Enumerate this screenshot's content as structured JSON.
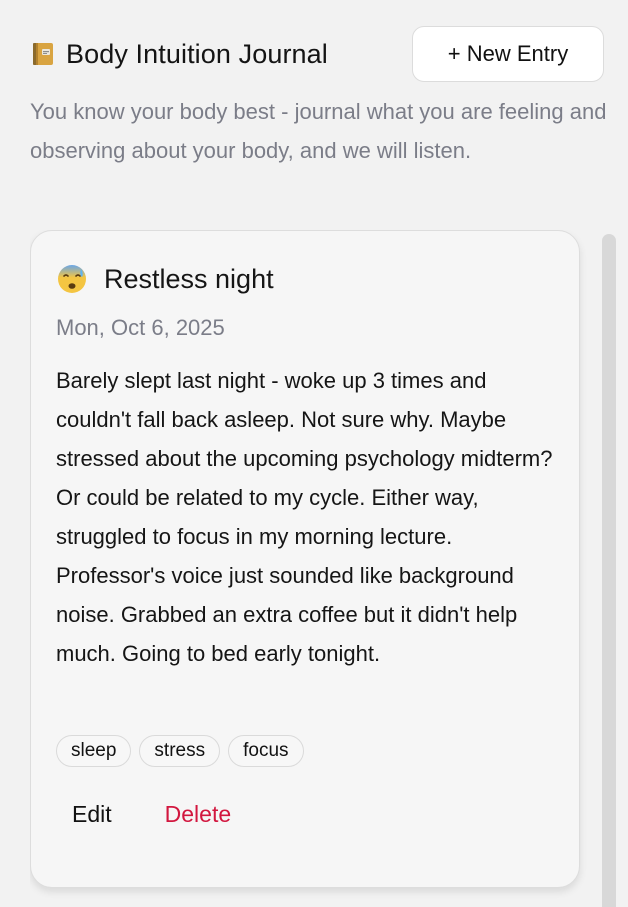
{
  "header": {
    "title": "Body Intuition Journal",
    "title_icon": "notebook-icon",
    "new_entry_label": "+ New Entry"
  },
  "subtitle": "You know your body best - journal what you are feeling and observing about your body, and we will listen.",
  "entries": [
    {
      "mood_icon": "anxious-sweat-face-icon",
      "title": "Restless night",
      "date": "Mon, Oct 6, 2025",
      "body": "Barely slept last night - woke up 3 times and couldn't fall back asleep. Not sure why. Maybe stressed about the upcoming psychology midterm? Or could be related to my cycle. Either way, struggled to focus in my morning lecture. Professor's voice just sounded like background noise. Grabbed an extra coffee but it didn't help much. Going to bed early tonight.",
      "tags": [
        "sleep",
        "stress",
        "focus"
      ],
      "edit_label": "Edit",
      "delete_label": "Delete"
    }
  ],
  "colors": {
    "background": "#f2f2f2",
    "card_background": "#f6f6f6",
    "muted_text": "#7b7d88",
    "delete": "#d2173f",
    "border": "#dddddd"
  }
}
